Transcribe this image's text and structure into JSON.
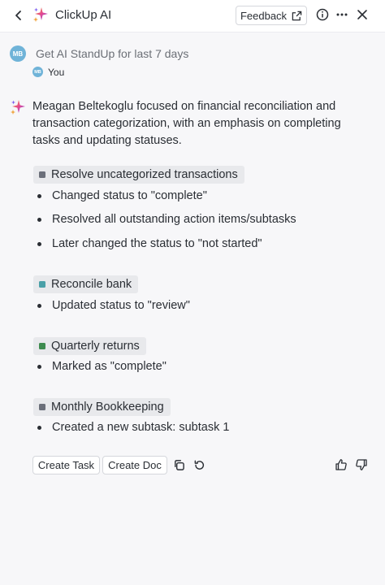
{
  "header": {
    "title": "ClickUp AI",
    "feedback_label": "Feedback",
    "icons": [
      "chevron-left-icon",
      "sparkle-icon",
      "external-link-icon",
      "info-icon",
      "more-icon",
      "close-icon"
    ]
  },
  "prompt": {
    "avatar_initials": "MB",
    "text": "Get AI StandUp for last 7 days",
    "author_initials": "MB",
    "author": "You"
  },
  "response": {
    "summary": "Meagan Beltekoglu focused on financial reconciliation and transaction categorization, with an emphasis on completing tasks and updating statuses.",
    "sections": [
      {
        "title": "Resolve uncategorized transactions",
        "color": "#6b6f7a",
        "items": [
          "Changed status to \"complete\"",
          "Resolved all outstanding action items/subtasks",
          "Later changed the status to \"not started\""
        ]
      },
      {
        "title": "Reconcile bank",
        "color": "#4aa0a8",
        "items": [
          "Updated status to \"review\""
        ]
      },
      {
        "title": "Quarterly returns",
        "color": "#3d8b4f",
        "items": [
          "Marked as \"complete\""
        ]
      },
      {
        "title": "Monthly Bookkeeping",
        "color": "#6b6f7a",
        "items": [
          "Created a new subtask: subtask 1"
        ]
      }
    ]
  },
  "actions": {
    "create_task": "Create Task",
    "create_doc": "Create Doc",
    "icons": [
      "copy-icon",
      "regenerate-icon",
      "thumbs-up-icon",
      "thumbs-down-icon"
    ]
  }
}
